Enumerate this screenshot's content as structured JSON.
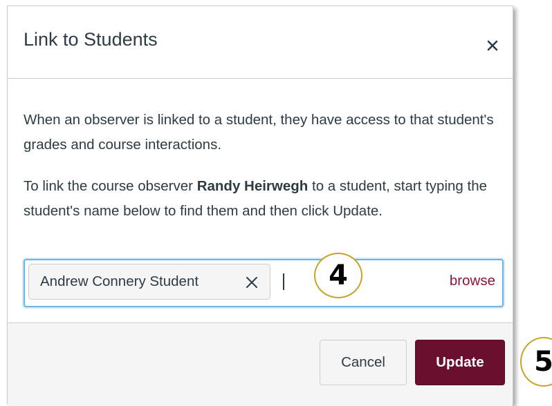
{
  "dialog": {
    "title": "Link to Students",
    "close_glyph": "×",
    "para1": "When an observer is linked to a student, they have access to that student's grades and course interactions.",
    "para2_prefix": "To link the course observer ",
    "observer_name": "Randy Heirwegh",
    "para2_suffix": " to a student, start typing the student's name below to find them and then click Update.",
    "selected_student": "Andrew Connery Student",
    "token_remove_glyph": "✕",
    "browse_label": "browse",
    "cancel_label": "Cancel",
    "update_label": "Update"
  },
  "annotations": {
    "step_4": "4",
    "step_5": "5"
  },
  "colors": {
    "accent": "#6b0f2f",
    "link": "#8b1538",
    "focus": "#6db3df",
    "annotation_ring": "#c9a227"
  },
  "icons": {
    "close": "close-icon",
    "remove_token": "remove-token-icon"
  }
}
